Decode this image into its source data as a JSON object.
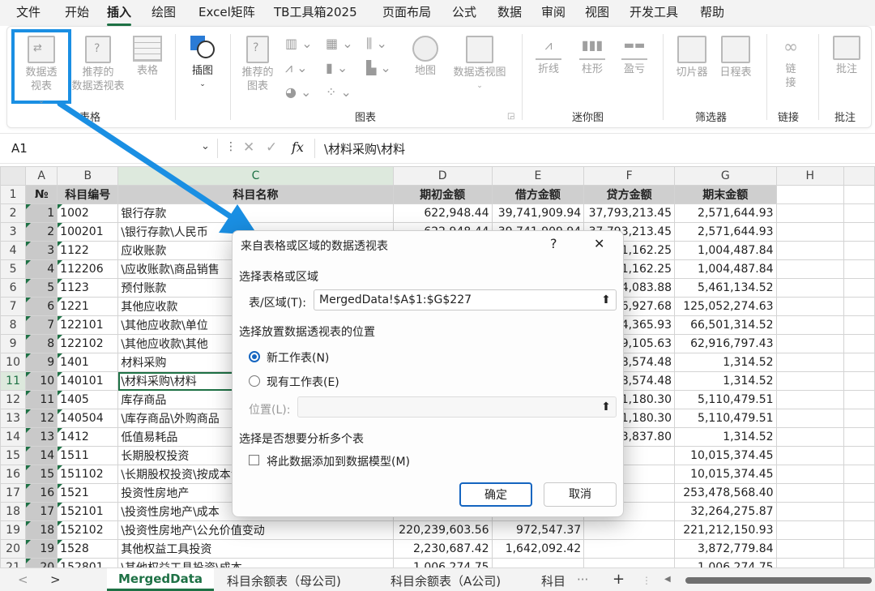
{
  "menu": {
    "tabs": [
      "文件",
      "开始",
      "插入",
      "绘图",
      "Excel矩阵",
      "TB工具箱2025",
      "页面布局",
      "公式",
      "数据",
      "审阅",
      "视图",
      "开发工具",
      "帮助"
    ],
    "active": "插入"
  },
  "ribbon": {
    "pivot_label": "数据透\n视表",
    "recommended_pivot_label": "推荐的\n数据透视表",
    "table_label": "表格",
    "illustration_label": "插图",
    "recommended_charts_label": "推荐的\n图表",
    "map_label": "地图",
    "pivot_chart_label": "数据透视图",
    "sparkline_line": "折线",
    "sparkline_column": "柱形",
    "sparkline_winloss": "盈亏",
    "slicer_label": "切片器",
    "timeline_label": "日程表",
    "link_label": "链\n接",
    "comment_label": "批注",
    "groups": {
      "tables": "表格",
      "charts": "图表",
      "sparklines": "迷你图",
      "filters": "筛选器",
      "links": "链接",
      "comments": "批注"
    }
  },
  "formula_bar": {
    "name_box": "A1",
    "fx": "fx",
    "formula": "\\材料采购\\材料"
  },
  "sheet": {
    "col_headers": [
      "A",
      "B",
      "C",
      "D",
      "E",
      "F",
      "G",
      "H"
    ],
    "header_row": [
      "№",
      "科目编号",
      "科目名称",
      "期初金额",
      "借方金额",
      "贷方金额",
      "期末金额"
    ],
    "rows": [
      [
        "1",
        "1002",
        "银行存款",
        "622,948.44",
        "39,741,909.94",
        "37,793,213.45",
        "2,571,644.93"
      ],
      [
        "2",
        "100201",
        "\\银行存款\\人民币",
        "622,948.44",
        "39,741,909.94",
        "37,793,213.45",
        "2,571,644.93"
      ],
      [
        "3",
        "1122",
        "应收账款",
        "",
        "",
        "391,162.25",
        "1,004,487.84"
      ],
      [
        "4",
        "112206",
        "\\应收账款\\商品销售",
        "",
        "",
        "391,162.25",
        "1,004,487.84"
      ],
      [
        "5",
        "1123",
        "预付账款",
        "",
        "",
        "484,083.88",
        "5,461,134.52"
      ],
      [
        "6",
        "1221",
        "其他应收款",
        "",
        "",
        "756,927.68",
        "125,052,274.63"
      ],
      [
        "7",
        "122101",
        "\\其他应收款\\单位",
        "",
        "",
        "204,365.93",
        "66,501,314.52"
      ],
      [
        "8",
        "122102",
        "\\其他应收款\\其他",
        "",
        "",
        "549,105.63",
        "62,916,797.43"
      ],
      [
        "9",
        "1401",
        "材料采购",
        "",
        "",
        "388,574.48",
        "1,314.52"
      ],
      [
        "10",
        "140101",
        "\\材料采购\\材料",
        "",
        "",
        "388,574.48",
        "1,314.52"
      ],
      [
        "11",
        "1405",
        "库存商品",
        "",
        "",
        "451,180.30",
        "5,110,479.51"
      ],
      [
        "12",
        "140504",
        "\\库存商品\\外购商品",
        "",
        "",
        "451,180.30",
        "5,110,479.51"
      ],
      [
        "13",
        "1412",
        "低值易耗品",
        "",
        "",
        "3,837.80",
        "1,314.52"
      ],
      [
        "14",
        "1511",
        "长期股权投资",
        "",
        "",
        "",
        "10,015,374.45"
      ],
      [
        "15",
        "151102",
        "\\长期股权投资\\按成本法",
        "",
        "",
        "",
        "10,015,374.45"
      ],
      [
        "16",
        "1521",
        "投资性房地产",
        "",
        "",
        "",
        "253,478,568.40"
      ],
      [
        "17",
        "152101",
        "\\投资性房地产\\成本",
        "",
        "",
        "",
        "32,264,275.87"
      ],
      [
        "18",
        "152102",
        "\\投资性房地产\\公允价值变动",
        "220,239,603.56",
        "972,547.37",
        "",
        "221,212,150.93"
      ],
      [
        "19",
        "1528",
        "其他权益工具投资",
        "2,230,687.42",
        "1,642,092.42",
        "",
        "3,872,779.84"
      ],
      [
        "20",
        "152801",
        "\\其他权益工具投资\\成本",
        "1,006,274.75",
        "",
        "",
        "1,006,274.75"
      ]
    ]
  },
  "dialog": {
    "title": "来自表格或区域的数据透视表",
    "help": "?",
    "close": "✕",
    "section_range": "选择表格或区域",
    "range_label": "表/区域(T):",
    "range_value": "MergedData!$A$1:$G$227",
    "section_location": "选择放置数据透视表的位置",
    "opt_new": "新工作表(N)",
    "opt_existing": "现有工作表(E)",
    "location_label": "位置(L):",
    "location_value": "",
    "section_multi": "选择是否想要分析多个表",
    "add_model": "将此数据添加到数据模型(M)",
    "ok": "确定",
    "cancel": "取消"
  },
  "sheet_tabs": {
    "tabs": [
      "MergedData",
      "科目余额表（母公司)",
      "科目余额表（A公司)",
      "科目"
    ],
    "active": "MergedData",
    "more": "···",
    "add": "+"
  },
  "colors": {
    "accent": "#1e7145",
    "highlight": "#1a8fe3"
  }
}
